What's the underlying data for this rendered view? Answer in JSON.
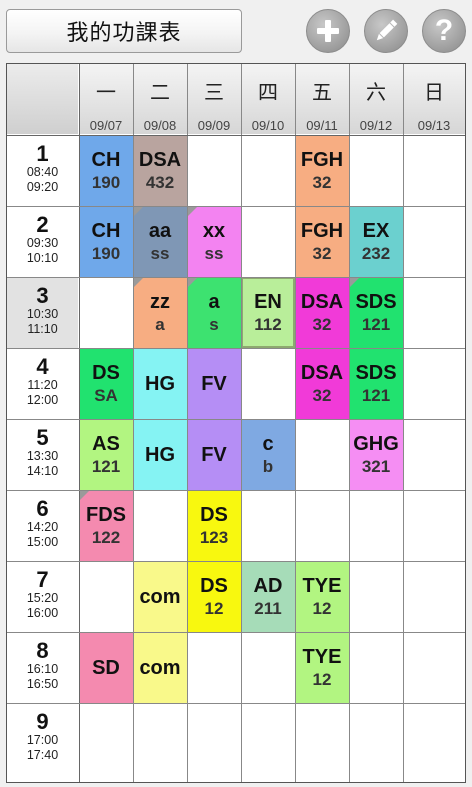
{
  "title": "我的功課表",
  "toolbar": {
    "add_icon": "plus-icon",
    "edit_icon": "pencil-icon",
    "help_icon": "question-icon",
    "help_glyph": "?"
  },
  "days": [
    {
      "wd": "一",
      "date": "09/07"
    },
    {
      "wd": "二",
      "date": "09/08"
    },
    {
      "wd": "三",
      "date": "09/09"
    },
    {
      "wd": "四",
      "date": "09/10"
    },
    {
      "wd": "五",
      "date": "09/11"
    },
    {
      "wd": "六",
      "date": "09/12"
    },
    {
      "wd": "日",
      "date": "09/13"
    }
  ],
  "periods": [
    {
      "num": "1",
      "start": "08:40",
      "end": "09:20"
    },
    {
      "num": "2",
      "start": "09:30",
      "end": "10:10"
    },
    {
      "num": "3",
      "start": "10:30",
      "end": "11:10"
    },
    {
      "num": "4",
      "start": "11:20",
      "end": "12:00"
    },
    {
      "num": "5",
      "start": "13:30",
      "end": "14:10"
    },
    {
      "num": "6",
      "start": "14:20",
      "end": "15:00"
    },
    {
      "num": "7",
      "start": "15:20",
      "end": "16:00"
    },
    {
      "num": "8",
      "start": "16:10",
      "end": "16:50"
    },
    {
      "num": "9",
      "start": "17:00",
      "end": "17:40"
    }
  ],
  "selected_period": "3",
  "classes": [
    {
      "day": 1,
      "period": 1,
      "name": "CH",
      "room": "190",
      "color": "#6fa8ea"
    },
    {
      "day": 2,
      "period": 1,
      "name": "DSA",
      "room": "432",
      "color": "#b9a49f"
    },
    {
      "day": 5,
      "period": 1,
      "name": "FGH",
      "room": "32",
      "color": "#f7ad82"
    },
    {
      "day": 1,
      "period": 2,
      "name": "CH",
      "room": "190",
      "color": "#6fa8ea"
    },
    {
      "day": 2,
      "period": 2,
      "name": "aa",
      "room": "ss",
      "color": "#7f97b5",
      "flag": true
    },
    {
      "day": 3,
      "period": 2,
      "name": "xx",
      "room": "ss",
      "color": "#f383f1",
      "flag": true
    },
    {
      "day": 5,
      "period": 2,
      "name": "FGH",
      "room": "32",
      "color": "#f7ad82"
    },
    {
      "day": 6,
      "period": 2,
      "name": "EX",
      "room": "232",
      "color": "#6bd0cf"
    },
    {
      "day": 2,
      "period": 3,
      "name": "zz",
      "room": "a",
      "color": "#f7ad82",
      "flag": true
    },
    {
      "day": 3,
      "period": 3,
      "name": "a",
      "room": "s",
      "color": "#3de270",
      "flag": true
    },
    {
      "day": 4,
      "period": 3,
      "name": "EN",
      "room": "112",
      "color": "#b9ee9a",
      "boxed": true
    },
    {
      "day": 5,
      "period": 3,
      "name": "DSA",
      "room": "32",
      "color": "#f13ad8"
    },
    {
      "day": 6,
      "period": 3,
      "name": "SDS",
      "room": "121",
      "color": "#21e26f",
      "flag": true
    },
    {
      "day": 1,
      "period": 4,
      "name": "DS",
      "room": "SA",
      "color": "#21e26f"
    },
    {
      "day": 2,
      "period": 4,
      "name": "HG",
      "room": "",
      "color": "#85f3f3"
    },
    {
      "day": 3,
      "period": 4,
      "name": "FV",
      "room": "",
      "color": "#b58ef5"
    },
    {
      "day": 5,
      "period": 4,
      "name": "DSA",
      "room": "32",
      "color": "#f13ad8"
    },
    {
      "day": 6,
      "period": 4,
      "name": "SDS",
      "room": "121",
      "color": "#21e26f"
    },
    {
      "day": 1,
      "period": 5,
      "name": "AS",
      "room": "121",
      "color": "#b2f581"
    },
    {
      "day": 2,
      "period": 5,
      "name": "HG",
      "room": "",
      "color": "#85f3f3"
    },
    {
      "day": 3,
      "period": 5,
      "name": "FV",
      "room": "",
      "color": "#b58ef5"
    },
    {
      "day": 4,
      "period": 5,
      "name": "c",
      "room": "b",
      "color": "#7fa9e2"
    },
    {
      "day": 6,
      "period": 5,
      "name": "GHG",
      "room": "321",
      "color": "#f58ef3"
    },
    {
      "day": 1,
      "period": 6,
      "name": "FDS",
      "room": "122",
      "color": "#f48aaf",
      "flag": true
    },
    {
      "day": 3,
      "period": 6,
      "name": "DS",
      "room": "123",
      "color": "#f8f80f"
    },
    {
      "day": 2,
      "period": 7,
      "name": "com",
      "room": "",
      "color": "#f9f98a"
    },
    {
      "day": 3,
      "period": 7,
      "name": "DS",
      "room": "12",
      "color": "#f8f80f"
    },
    {
      "day": 4,
      "period": 7,
      "name": "AD",
      "room": "211",
      "color": "#a6dcb8"
    },
    {
      "day": 5,
      "period": 7,
      "name": "TYE",
      "room": "12",
      "color": "#b2f581"
    },
    {
      "day": 1,
      "period": 8,
      "name": "SD",
      "room": "",
      "color": "#f48aaf"
    },
    {
      "day": 2,
      "period": 8,
      "name": "com",
      "room": "",
      "color": "#f9f98a"
    },
    {
      "day": 5,
      "period": 8,
      "name": "TYE",
      "room": "12",
      "color": "#b2f581"
    }
  ]
}
